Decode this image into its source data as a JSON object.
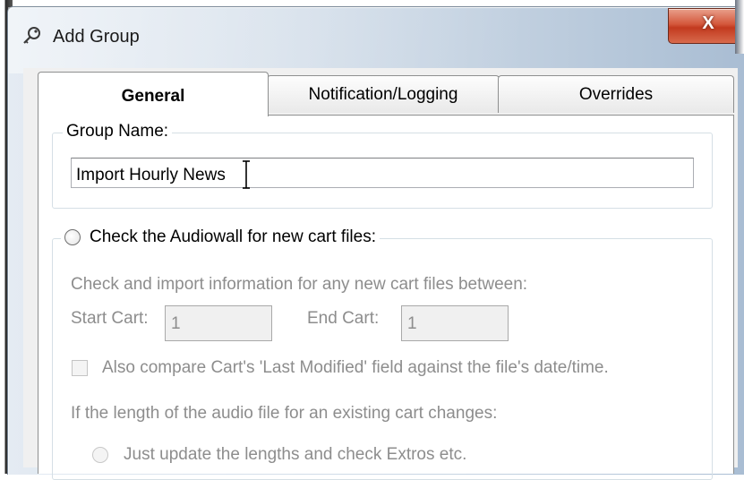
{
  "window": {
    "title": "Add Group",
    "close_glyph": "X",
    "title_icon": "key-icon"
  },
  "tabs": [
    {
      "label": "General",
      "selected": true
    },
    {
      "label": "Notification/Logging",
      "selected": false
    },
    {
      "label": "Overrides",
      "selected": false
    }
  ],
  "group_name": {
    "legend": "Group Name:",
    "value": "Import Hourly News"
  },
  "audiowall": {
    "radio_label": "Check the Audiowall for new cart files:",
    "description": "Check and import information for any new cart files between:",
    "start_cart_label": "Start Cart:",
    "start_cart_value": "1",
    "end_cart_label": "End Cart:",
    "end_cart_value": "1",
    "compare_label": "Also compare Cart's 'Last Modified' field against the file's date/time.",
    "length_change_label": "If the length of the audio file for an existing cart changes:",
    "update_option_label": "Just update the lengths and check Extros etc."
  },
  "colors": {
    "close_button": "#c8442a",
    "disabled_text": "#8d8d8d"
  }
}
